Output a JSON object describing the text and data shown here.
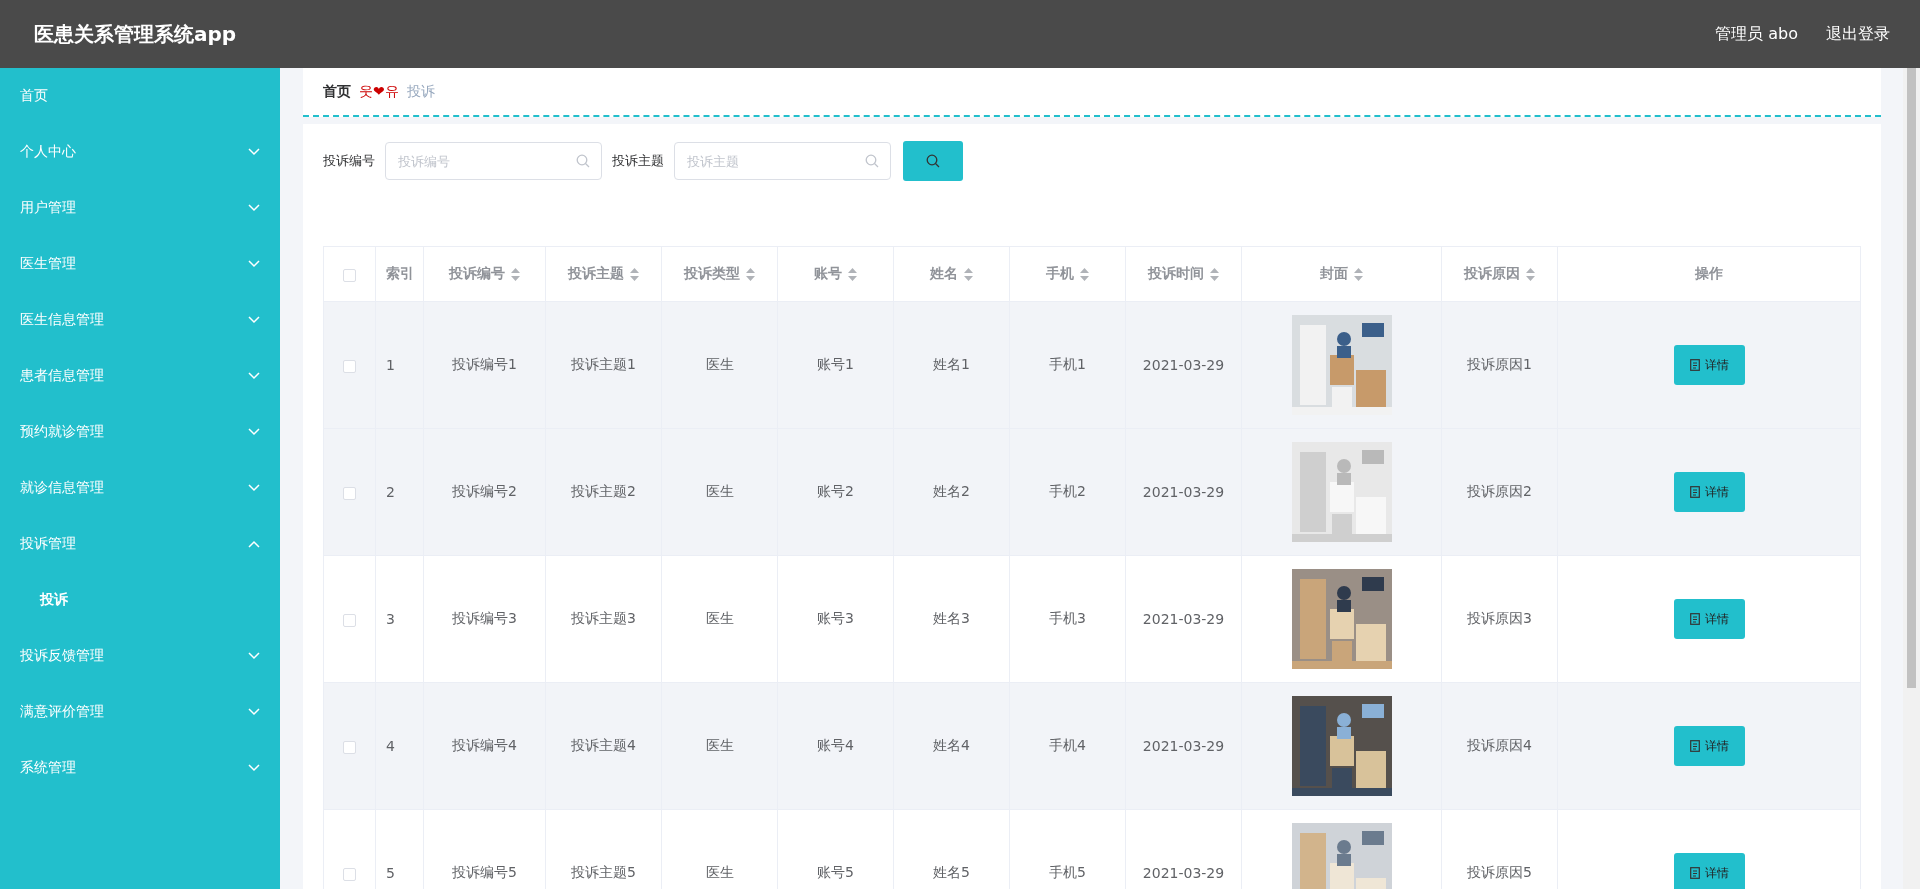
{
  "header": {
    "title": "医患关系管理系统app",
    "user": "管理员 abo",
    "logout": "退出登录"
  },
  "sidebar": {
    "items": [
      {
        "kind": "link",
        "label": "首页"
      },
      {
        "kind": "group",
        "label": "个人中心",
        "expanded": false
      },
      {
        "kind": "group",
        "label": "用户管理",
        "expanded": false
      },
      {
        "kind": "group",
        "label": "医生管理",
        "expanded": false
      },
      {
        "kind": "group",
        "label": "医生信息管理",
        "expanded": false
      },
      {
        "kind": "group",
        "label": "患者信息管理",
        "expanded": false
      },
      {
        "kind": "group",
        "label": "预约就诊管理",
        "expanded": false
      },
      {
        "kind": "group",
        "label": "就诊信息管理",
        "expanded": false
      },
      {
        "kind": "group",
        "label": "投诉管理",
        "expanded": true,
        "children": [
          {
            "label": "投诉"
          }
        ]
      },
      {
        "kind": "group",
        "label": "投诉反馈管理",
        "expanded": false
      },
      {
        "kind": "group",
        "label": "满意评价管理",
        "expanded": false
      },
      {
        "kind": "group",
        "label": "系统管理",
        "expanded": false
      }
    ]
  },
  "breadcrumb": {
    "items": [
      "首页",
      "投诉"
    ],
    "separator": "웃❤유"
  },
  "search": {
    "fields": [
      {
        "label": "投诉编号",
        "placeholder": "投诉编号"
      },
      {
        "label": "投诉主题",
        "placeholder": "投诉主题"
      }
    ]
  },
  "table": {
    "all_checked": false,
    "columns": [
      {
        "label": "索引",
        "sortable": false
      },
      {
        "label": "投诉编号",
        "sortable": true
      },
      {
        "label": "投诉主题",
        "sortable": true
      },
      {
        "label": "投诉类型",
        "sortable": true
      },
      {
        "label": "账号",
        "sortable": true
      },
      {
        "label": "姓名",
        "sortable": true
      },
      {
        "label": "手机",
        "sortable": true
      },
      {
        "label": "投诉时间",
        "sortable": true
      },
      {
        "label": "封面",
        "sortable": true
      },
      {
        "label": "投诉原因",
        "sortable": true
      },
      {
        "label": "操作",
        "sortable": false
      }
    ],
    "rows": [
      {
        "checked": false,
        "shaded": true,
        "cells": [
          "1",
          "投诉编号1",
          "投诉主题1",
          "医生",
          "账号1",
          "姓名1",
          "手机1",
          "2021-03-29"
        ],
        "reason": "投诉原因1",
        "action": "详情"
      },
      {
        "checked": false,
        "shaded": true,
        "cells": [
          "2",
          "投诉编号2",
          "投诉主题2",
          "医生",
          "账号2",
          "姓名2",
          "手机2",
          "2021-03-29"
        ],
        "reason": "投诉原因2",
        "action": "详情"
      },
      {
        "checked": false,
        "shaded": false,
        "cells": [
          "3",
          "投诉编号3",
          "投诉主题3",
          "医生",
          "账号3",
          "姓名3",
          "手机3",
          "2021-03-29"
        ],
        "reason": "投诉原因3",
        "action": "详情"
      },
      {
        "checked": false,
        "shaded": true,
        "cells": [
          "4",
          "投诉编号4",
          "投诉主题4",
          "医生",
          "账号4",
          "姓名4",
          "手机4",
          "2021-03-29"
        ],
        "reason": "投诉原因4",
        "action": "详情"
      },
      {
        "checked": false,
        "shaded": false,
        "cells": [
          "5",
          "投诉编号5",
          "投诉主题5",
          "医生",
          "账号5",
          "姓名5",
          "手机5",
          "2021-03-29"
        ],
        "reason": "投诉原因5",
        "action": "详情"
      }
    ]
  }
}
